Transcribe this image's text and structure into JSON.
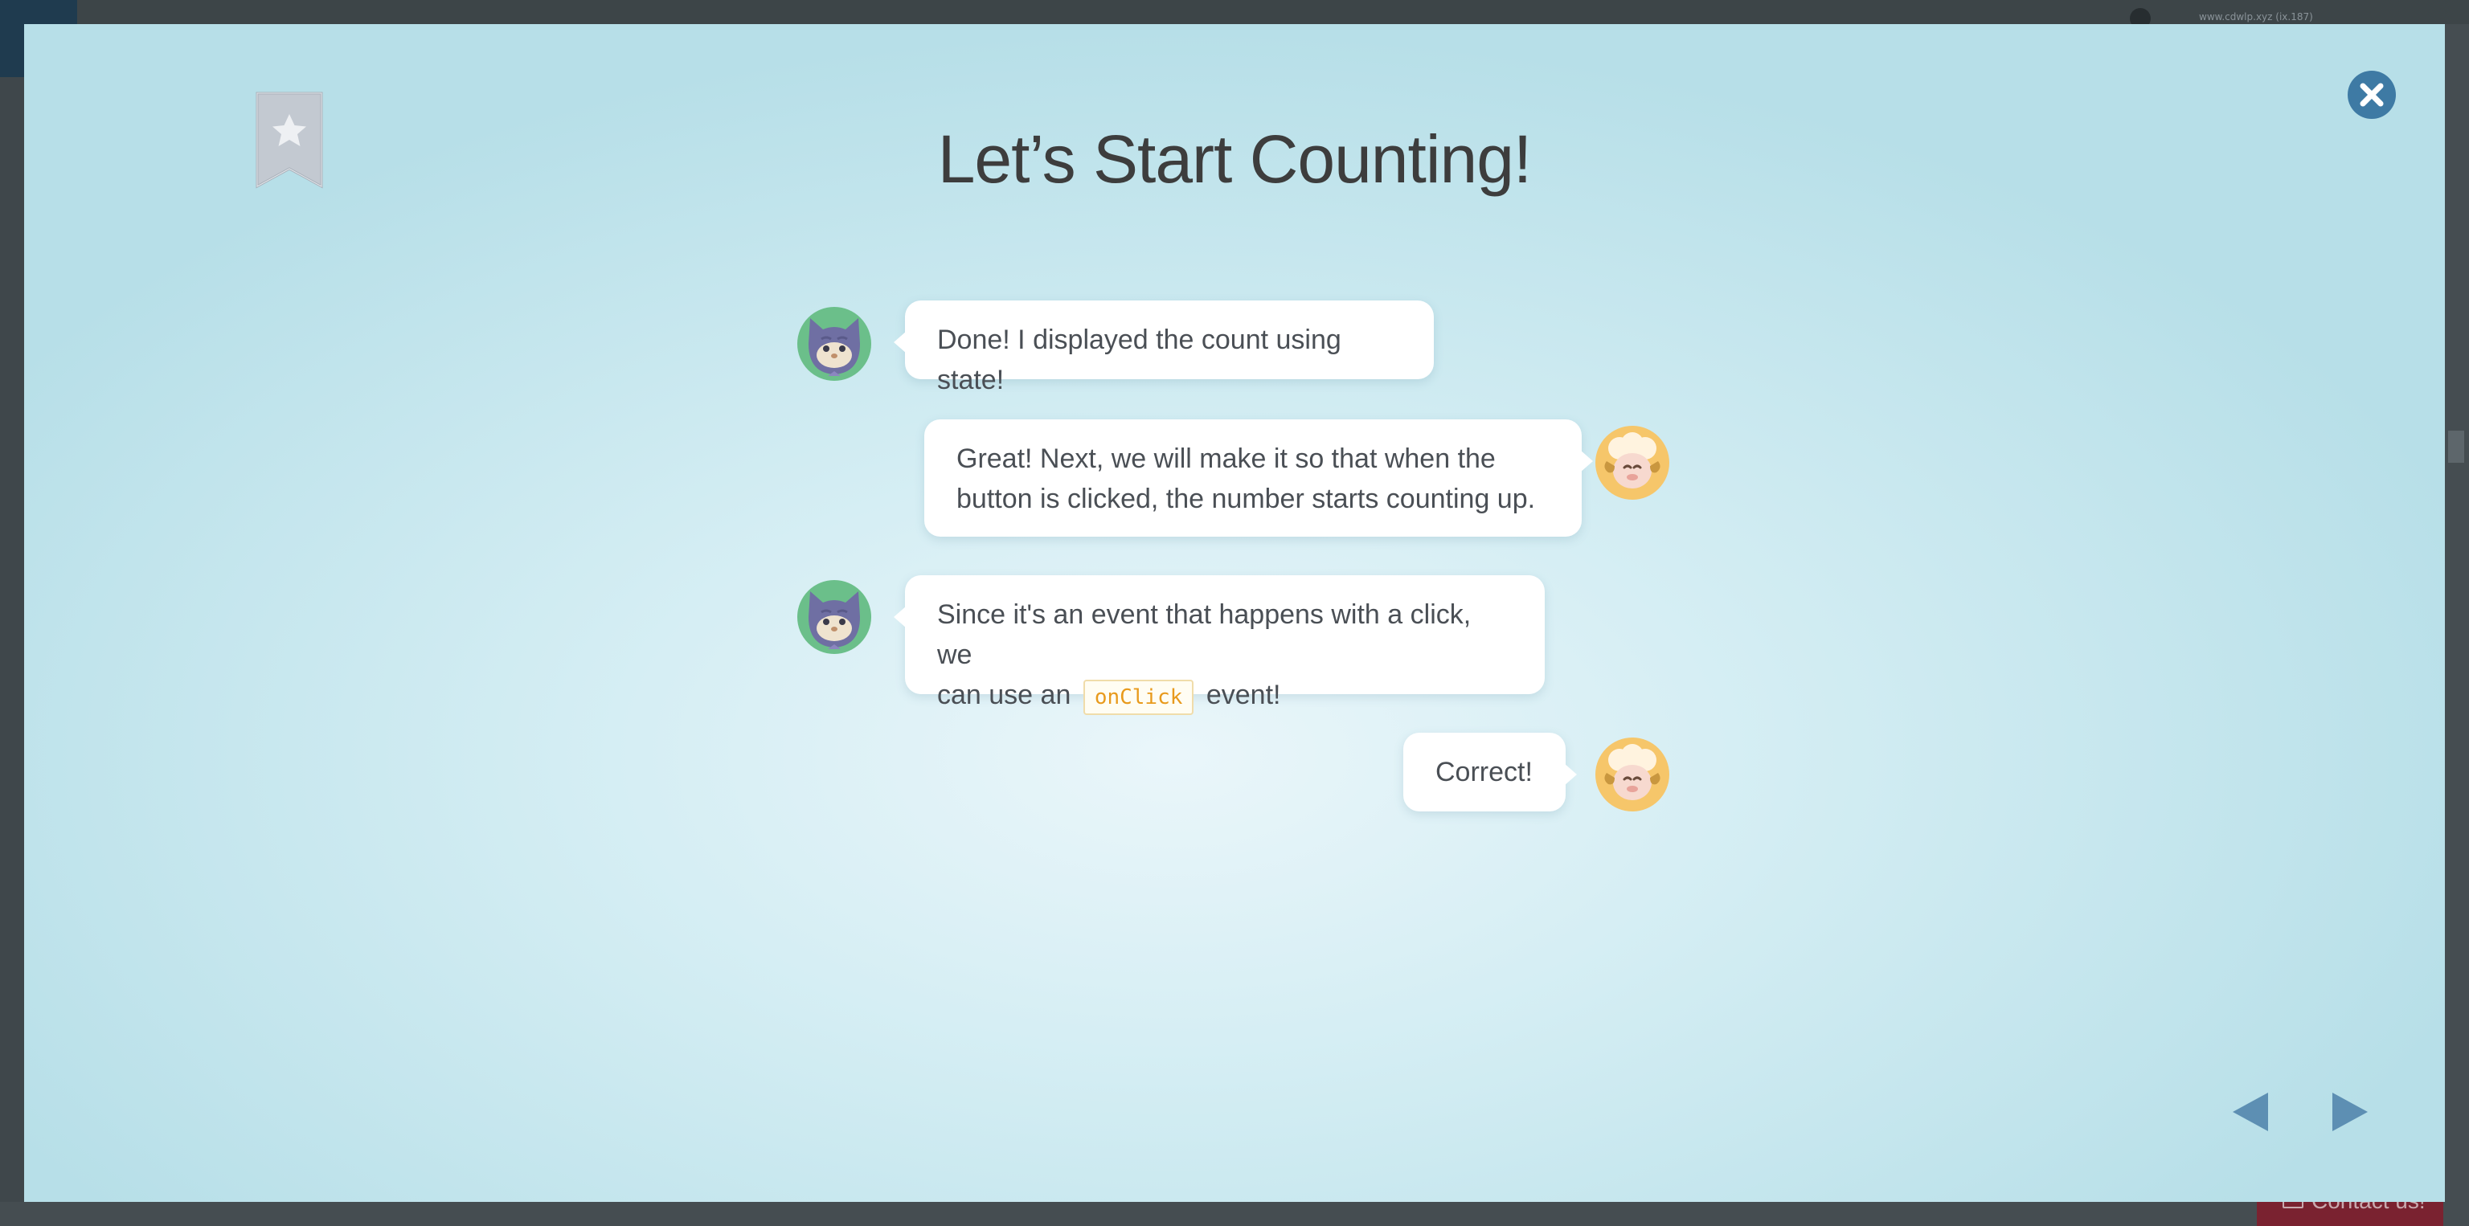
{
  "background": {
    "url_text": "www.cdwlp.xyz (ix.187)",
    "contact_label": "Contact us!"
  },
  "modal": {
    "title": "Let’s Start Counting!",
    "bookmark_icon": "star-bookmark-icon",
    "close_icon": "close-icon",
    "nav": {
      "prev_icon": "triangle-left-icon",
      "next_icon": "triangle-right-icon"
    }
  },
  "messages": [
    {
      "speaker": "cat",
      "side": "left",
      "text": "Done! I displayed the count using state!"
    },
    {
      "speaker": "sheep",
      "side": "right",
      "lines": [
        "Great! Next, we will make it so that when the",
        "button is clicked, the number starts counting up."
      ]
    },
    {
      "speaker": "cat",
      "side": "left",
      "line1": "Since it's an event that happens with a click, we",
      "line2_before": "can use an",
      "code": "onClick",
      "line2_after": "event!"
    },
    {
      "speaker": "sheep",
      "side": "right",
      "text": "Correct!"
    }
  ],
  "colors": {
    "accent": "#3e7aa4",
    "cat_avatar_bg": "#6bbf8a",
    "sheep_avatar_bg": "#f6c66a",
    "code_text": "#e89a1c"
  }
}
